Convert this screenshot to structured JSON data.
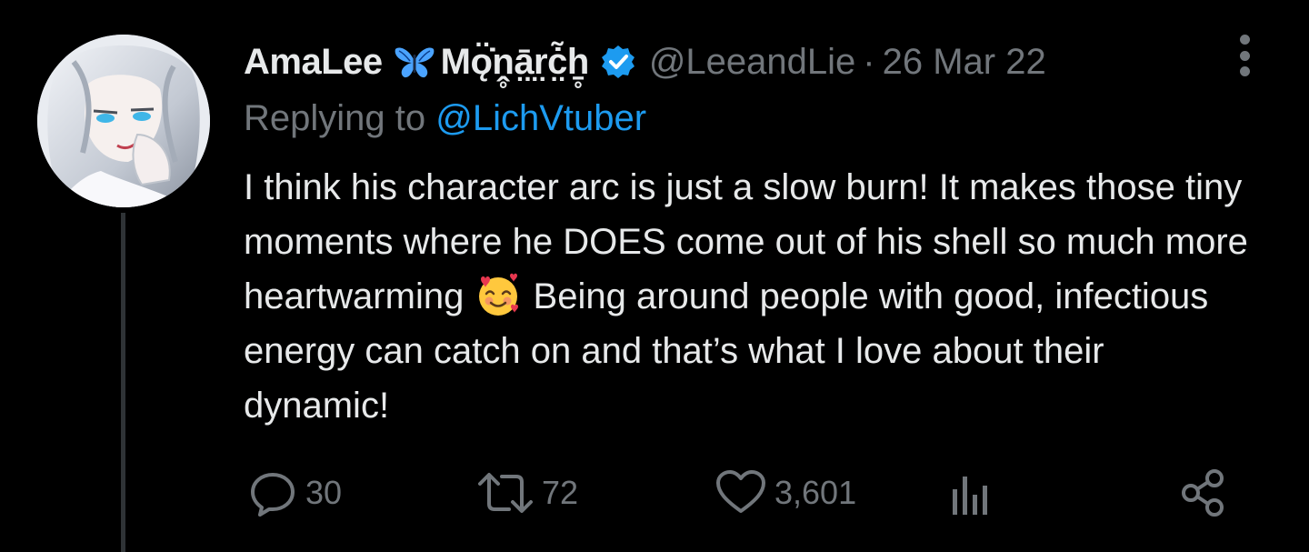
{
  "tweet": {
    "author": {
      "display_name": "AmaLee",
      "name_suffix": "Mǫ̈̇ṋ̥ā̤r̤ċ̤̃ẖ̥",
      "handle": "@LeeandLie",
      "verified": true,
      "avatar_icon": "avatar-image"
    },
    "separator": "·",
    "date": "26 Mar 22",
    "replying_prefix": "Replying to ",
    "replying_to": "@LichVtuber",
    "text_before_emoji": "I think his character arc is just a slow burn! It makes those tiny moments where he DOES come out of his shell so much more heartwarming ",
    "text_after_emoji": " Being around people with good, infectious energy can catch on and that’s what I love about their dynamic!",
    "emoji": "smiling-face-with-hearts-emoji",
    "actions": {
      "reply_count": "30",
      "retweet_count": "72",
      "like_count": "3,601",
      "views_icon": "analytics-icon",
      "share_icon": "share-icon"
    }
  },
  "colors": {
    "background": "#000000",
    "text_primary": "#e7e9ea",
    "text_secondary": "#71767b",
    "accent": "#1d9bf0",
    "thread_line": "#2f3336"
  }
}
